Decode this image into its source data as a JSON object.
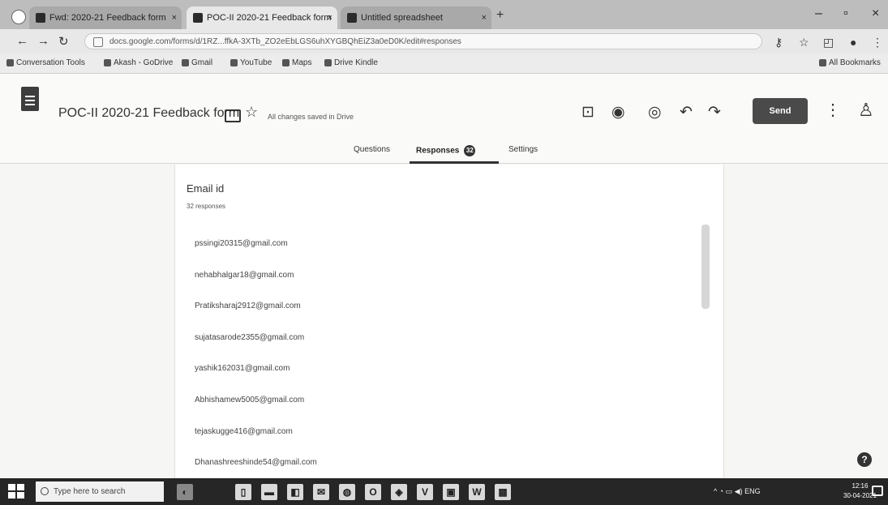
{
  "browser": {
    "tabs": [
      {
        "label": "Fwd: 2020-21 Feedback form",
        "icon": "mail-icon"
      },
      {
        "label": "POC-II 2020-21 Feedback form",
        "icon": "forms-icon"
      },
      {
        "label": "Untitled spreadsheet",
        "icon": "sheets-icon"
      }
    ],
    "new_tab": "+",
    "window_controls": {
      "minimize": "–",
      "maximize": "▫",
      "close": "×"
    },
    "nav": {
      "back": "←",
      "forward": "→",
      "reload": "↻"
    },
    "url": "docs.google.com/forms/d/1RZ...ffkA-3XTb_ZO2eEbLGS6uhXYGBQhEiZ3a0eD0K/edit#responses",
    "bookmarks": [
      "Conversation Tools",
      "Akash - GoDrive",
      "Gmail",
      "YouTube",
      "Maps",
      "Drive Kindle"
    ],
    "all_bookmarks": "All Bookmarks"
  },
  "form": {
    "title": "POC-II 2020-21 Feedback form",
    "saved_status": "All changes saved in Drive",
    "send_label": "Send",
    "tabs": {
      "questions": "Questions",
      "responses": "Responses",
      "responses_count": "32",
      "settings": "Settings"
    }
  },
  "question": {
    "title": "Email id",
    "count": "32 responses",
    "responses": [
      "pssingi20315@gmail.com",
      "nehabhalgar18@gmail.com",
      "Pratiksharaj2912@gmail.com",
      "sujatasarode2355@gmail.com",
      "yashik162031@gmail.com",
      "Abhishamew5005@gmail.com",
      "tejaskugge416@gmail.com",
      "Dhanashreeshinde54@gmail.com"
    ]
  },
  "taskbar": {
    "search_placeholder": "Type here to search",
    "clock_time": "12:16",
    "clock_date": "30-04-2021"
  }
}
